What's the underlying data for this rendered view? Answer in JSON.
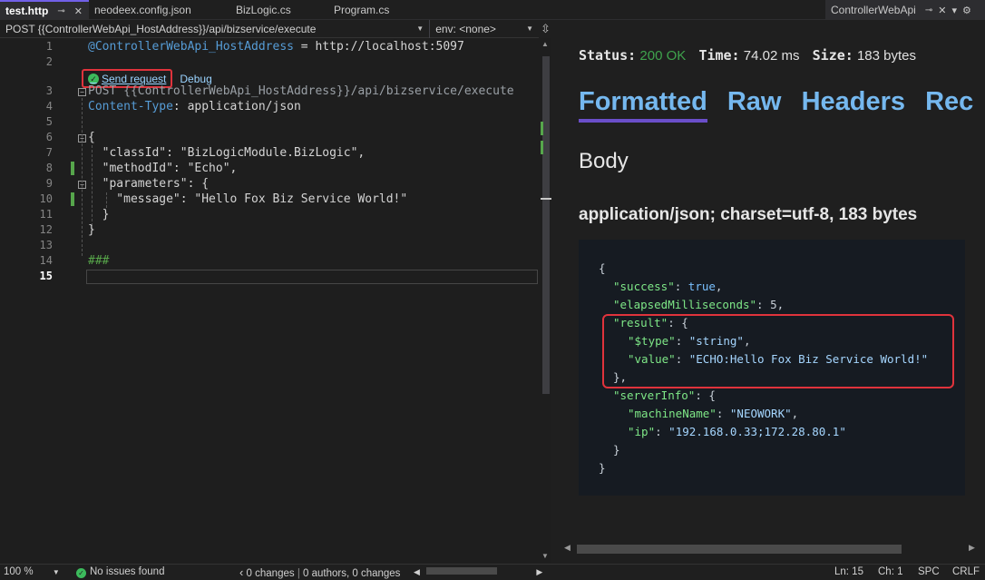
{
  "tabs": [
    {
      "label": "test.http",
      "active": true
    },
    {
      "label": "neodeex.config.json"
    },
    {
      "label": "BizLogic.cs"
    },
    {
      "label": "Program.cs"
    }
  ],
  "right_tab": {
    "label": "ControllerWebApi"
  },
  "nav": {
    "member": "POST {{ControllerWebApi_HostAddress}}/api/bizservice/execute",
    "env": "env: <none>"
  },
  "editor": {
    "line_numbers": [
      "1",
      "2",
      "3",
      "4",
      "5",
      "6",
      "7",
      "8",
      "9",
      "10",
      "11",
      "12",
      "13",
      "14",
      "15"
    ],
    "current_line": "15",
    "codelens": {
      "send": "Send request",
      "debug": "Debug"
    },
    "line1": {
      "var": "@ControllerWebApi_HostAddress",
      "rest": " = http://localhost:5097"
    },
    "line3": "POST {{ControllerWebApi_HostAddress}}/api/bizservice/execute",
    "line4": {
      "key": "Content-Type",
      "rest": ": application/json"
    },
    "line6": "{",
    "line7": "  \"classId\": \"BizLogicModule.BizLogic\",",
    "line8": "  \"methodId\": \"Echo\",",
    "line9": "  \"parameters\": {",
    "line10": "    \"message\": \"Hello Fox Biz Service World!\"",
    "line11": "  }",
    "line12": "}",
    "line14": "###"
  },
  "response": {
    "status_label": "Status:",
    "status_value": "200 OK",
    "time_label": "Time:",
    "time_value": "74.02 ms",
    "size_label": "Size:",
    "size_value": "183 bytes",
    "tabs": [
      "Formatted",
      "Raw",
      "Headers",
      "Rec"
    ],
    "body_heading": "Body",
    "content_type": "application/json; charset=utf-8, 183 bytes",
    "json": {
      "open": "{",
      "success_key": "\"success\"",
      "success_val": "true",
      "elapsed_key": "\"elapsedMilliseconds\"",
      "elapsed_val": "5",
      "result_key": "\"result\"",
      "type_key": "\"$type\"",
      "type_val": "\"string\"",
      "value_key": "\"value\"",
      "value_val": "\"ECHO:Hello Fox Biz Service World!\"",
      "result_close": "},",
      "server_key": "\"serverInfo\"",
      "machine_key": "\"machineName\"",
      "machine_val": "\"NEOWORK\"",
      "ip_key": "\"ip\"",
      "ip_val": "\"192.168.0.33;172.28.80.1\"",
      "server_close": "}",
      "close": "}"
    }
  },
  "statusbar": {
    "zoom": "100 %",
    "issues": "No issues found",
    "changes": "0 changes",
    "authors": "0 authors, 0 changes",
    "ln": "Ln: 15",
    "ch": "Ch: 1",
    "spc": "SPC",
    "crlf": "CRLF"
  }
}
